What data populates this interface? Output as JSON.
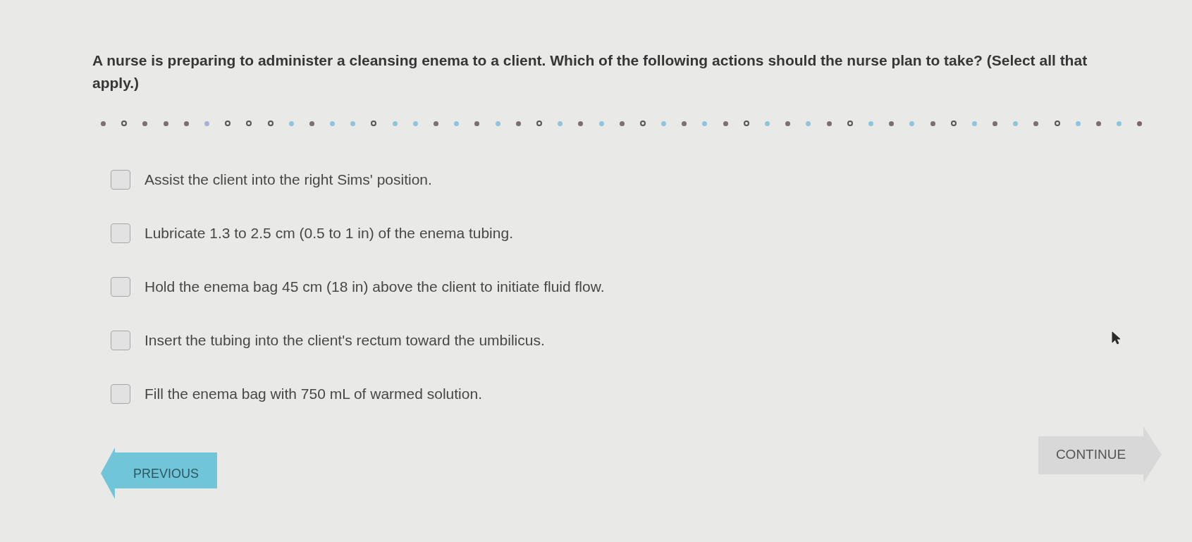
{
  "question": "A nurse is preparing to administer a cleansing enema to a client. Which of the following actions should the nurse plan to take? (Select all that apply.)",
  "progress_dots": [
    {
      "kind": "dot",
      "color": "#7b6f6f"
    },
    {
      "kind": "ring",
      "color": "#5a5454"
    },
    {
      "kind": "dot",
      "color": "#7b6f6f"
    },
    {
      "kind": "dot",
      "color": "#7b6f6f"
    },
    {
      "kind": "dot",
      "color": "#7b6f6f"
    },
    {
      "kind": "dot",
      "color": "#a9b1d2"
    },
    {
      "kind": "ring",
      "color": "#5a5454"
    },
    {
      "kind": "ring",
      "color": "#5a5454"
    },
    {
      "kind": "ring",
      "color": "#5a5454"
    },
    {
      "kind": "dot",
      "color": "#8ec5dc"
    },
    {
      "kind": "dot",
      "color": "#7b6f6f"
    },
    {
      "kind": "dot",
      "color": "#8ec5dc"
    },
    {
      "kind": "dot",
      "color": "#8ec5dc"
    },
    {
      "kind": "ring",
      "color": "#5a5454"
    },
    {
      "kind": "dot",
      "color": "#8ec5dc"
    },
    {
      "kind": "dot",
      "color": "#8ec5dc"
    },
    {
      "kind": "dot",
      "color": "#7b6f6f"
    },
    {
      "kind": "dot",
      "color": "#8ec5dc"
    },
    {
      "kind": "dot",
      "color": "#7b6f6f"
    },
    {
      "kind": "dot",
      "color": "#8ec5dc"
    },
    {
      "kind": "dot",
      "color": "#7b6f6f"
    },
    {
      "kind": "ring",
      "color": "#5a5454"
    },
    {
      "kind": "dot",
      "color": "#8ec5dc"
    },
    {
      "kind": "dot",
      "color": "#7b6f6f"
    },
    {
      "kind": "dot",
      "color": "#8ec5dc"
    },
    {
      "kind": "dot",
      "color": "#7b6f6f"
    },
    {
      "kind": "ring",
      "color": "#5a5454"
    },
    {
      "kind": "dot",
      "color": "#8ec5dc"
    },
    {
      "kind": "dot",
      "color": "#7b6f6f"
    },
    {
      "kind": "dot",
      "color": "#8ec5dc"
    },
    {
      "kind": "dot",
      "color": "#7b6f6f"
    },
    {
      "kind": "ring",
      "color": "#5a5454"
    },
    {
      "kind": "dot",
      "color": "#8ec5dc"
    },
    {
      "kind": "dot",
      "color": "#7b6f6f"
    },
    {
      "kind": "dot",
      "color": "#8ec5dc"
    },
    {
      "kind": "dot",
      "color": "#7b6f6f"
    },
    {
      "kind": "ring",
      "color": "#5a5454"
    },
    {
      "kind": "dot",
      "color": "#8ec5dc"
    },
    {
      "kind": "dot",
      "color": "#7b6f6f"
    },
    {
      "kind": "dot",
      "color": "#8ec5dc"
    },
    {
      "kind": "dot",
      "color": "#7b6f6f"
    },
    {
      "kind": "ring",
      "color": "#5a5454"
    },
    {
      "kind": "dot",
      "color": "#8ec5dc"
    },
    {
      "kind": "dot",
      "color": "#7b6f6f"
    },
    {
      "kind": "dot",
      "color": "#8ec5dc"
    },
    {
      "kind": "dot",
      "color": "#7b6f6f"
    },
    {
      "kind": "ring",
      "color": "#5a5454"
    },
    {
      "kind": "dot",
      "color": "#8ec5dc"
    },
    {
      "kind": "dot",
      "color": "#7b6f6f"
    },
    {
      "kind": "dot",
      "color": "#8ec5dc"
    },
    {
      "kind": "dot",
      "color": "#7e6470"
    }
  ],
  "options": [
    {
      "label": "Assist the client into the right Sims' position.",
      "checked": false
    },
    {
      "label": "Lubricate 1.3 to 2.5 cm (0.5 to 1 in) of the enema tubing.",
      "checked": false
    },
    {
      "label": "Hold the enema bag 45 cm (18 in) above the client to initiate fluid flow.",
      "checked": false
    },
    {
      "label": "Insert the tubing into the client's rectum toward the umbilicus.",
      "checked": false
    },
    {
      "label": "Fill the enema bag with 750 mL of warmed solution.",
      "checked": false
    }
  ],
  "buttons": [
    {
      "kind": "back",
      "label": "PREVIOUS"
    },
    {
      "kind": "forward",
      "label": "CONTINUE"
    }
  ]
}
